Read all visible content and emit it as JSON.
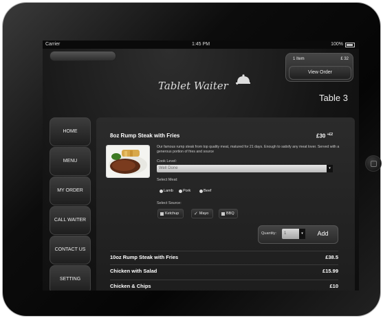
{
  "status_bar": {
    "carrier": "Carrier",
    "time": "1:45 PM",
    "battery": "100%"
  },
  "cart": {
    "items": "1 Item",
    "total": "£ 32",
    "view_label": "View Order"
  },
  "brand": {
    "logo_text": "Tablet Waiter"
  },
  "table_label": "Table 3",
  "nav": {
    "home": "HOME",
    "menu": "MENU",
    "my_order": "MY ORDER",
    "call_waiter": "CALL WAITER",
    "contact_us": "CONTACT US",
    "setting": "SETTING"
  },
  "selected_item": {
    "name": "8oz Rump Steak with Fries",
    "price": "£30",
    "price_extra": "+£2",
    "description": "Our famous rump steak from top quality meat, matured for 21 days. Enough to satisfy any meat lover. Served with a generous portion of fries and source",
    "cook_level_label": "Cook Level:",
    "cook_level_value": "Well Done",
    "meat_label": "Select Meat:",
    "meat_options": [
      "Lamb",
      "Pork",
      "Beef"
    ],
    "source_label": "Select Source:",
    "source_options": [
      "Ketchup",
      "Mayo",
      "BBQ"
    ],
    "quantity_label": "Quantity:",
    "quantity_value": "1",
    "add_label": "Add"
  },
  "menu_items": [
    {
      "name": "10oz Rump Steak with Fries",
      "price": "£38.5"
    },
    {
      "name": "Chicken with Salad",
      "price": "£15.99"
    },
    {
      "name": "Chicken & Chips",
      "price": "£10"
    }
  ]
}
